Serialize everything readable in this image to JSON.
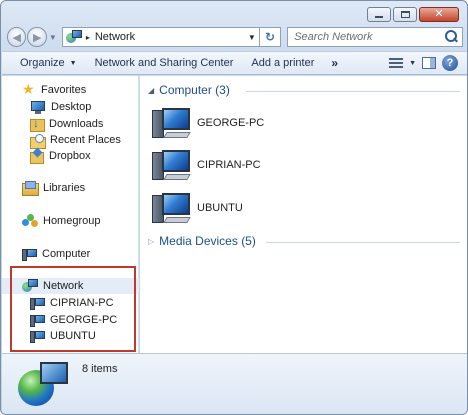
{
  "window": {
    "caption_buttons": {
      "minimize": "",
      "maximize": "",
      "close": "✕"
    }
  },
  "navbar": {
    "back_glyph": "◀",
    "forward_glyph": "▶",
    "address_separator": "▸",
    "address_text": "Network",
    "address_dropdown": "▼",
    "refresh_glyph": "↻",
    "search_placeholder": "Search Network"
  },
  "commandbar": {
    "organize": "Organize",
    "dropdown_glyph": "▼",
    "network_sharing": "Network and Sharing Center",
    "add_printer": "Add a printer",
    "more": "»",
    "help": "?"
  },
  "navpane": {
    "favorites": {
      "label": "Favorites",
      "items": [
        {
          "label": "Desktop"
        },
        {
          "label": "Downloads"
        },
        {
          "label": "Recent Places"
        },
        {
          "label": "Dropbox"
        }
      ]
    },
    "libraries": {
      "label": "Libraries"
    },
    "homegroup": {
      "label": "Homegroup"
    },
    "computer": {
      "label": "Computer"
    },
    "network": {
      "label": "Network",
      "items": [
        {
          "label": "CIPRIAN-PC"
        },
        {
          "label": "GEORGE-PC"
        },
        {
          "label": "UBUNTU"
        }
      ]
    }
  },
  "content": {
    "computer_group": {
      "title": "Computer (3)",
      "expand_glyph": "◢",
      "items": [
        {
          "label": "GEORGE-PC"
        },
        {
          "label": "CIPRIAN-PC"
        },
        {
          "label": "UBUNTU"
        }
      ]
    },
    "media_group": {
      "title": "Media Devices (5)",
      "expand_glyph": "▷"
    }
  },
  "details": {
    "count": "8 items"
  },
  "colors": {
    "highlight_border": "#c0392b",
    "group_title": "#1e4e8c",
    "selected_item_bg": "#e4ecf7"
  }
}
